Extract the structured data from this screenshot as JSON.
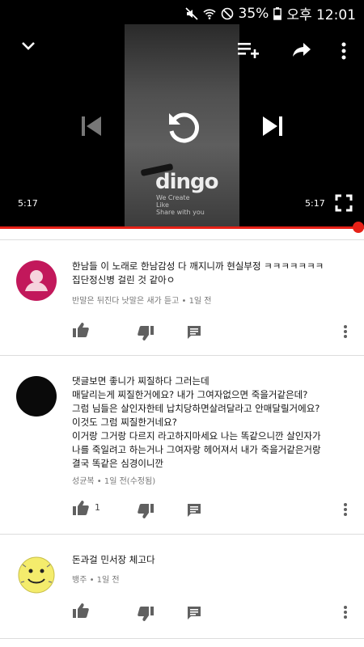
{
  "status_bar": {
    "battery": "35%",
    "time": "오후 12:01"
  },
  "player": {
    "elapsed": "5:17",
    "duration": "5:17",
    "progress": 1.0,
    "brand": "dingo",
    "brand_tagline": [
      "We Create",
      "Like",
      "Share with you"
    ]
  },
  "comments": [
    {
      "text": "한남들 이 노래로 한남감성 다 깨지니까 현실부정 ㅋㅋㅋㅋㅋㅋㅋ\n집단정신병 걸린 것 같아ㅇ",
      "meta": "반말은 뒤진다 낫말은 새가 듣고 • 1일 전",
      "likes": ""
    },
    {
      "text": "댓글보면 좋니가 찌질하다 그러는데\n매달리는게 찌질한거에요? 내가 그여자없으면 죽을거같은데?\n그럼 님들은 살인자한테 납치당하면살려달라고 안매달릴거에요?\n이것도 그럼 찌질한거네요?\n이거랑 그거랑 다르지 라고하지마세요 나는 똑같으니깐 살인자가\n나를 죽일려고 하는거나 그여자랑 헤어져서 내가 죽을거같은거랑\n결국 똑같은 심경이니깐",
      "meta": "성균복 • 1일 전(수정됨)",
      "likes": "1"
    },
    {
      "text": "돈과걸 민서장 체고다",
      "meta": "뱅주 • 1일 전",
      "likes": ""
    }
  ]
}
